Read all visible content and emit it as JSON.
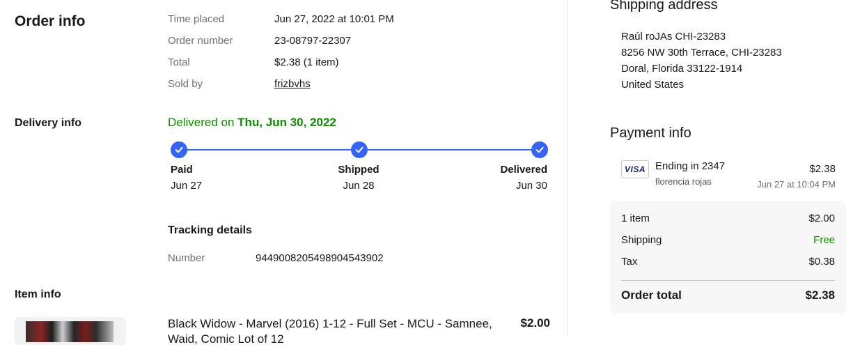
{
  "order_info": {
    "title": "Order info",
    "rows": [
      {
        "label": "Time placed",
        "value": "Jun 27, 2022 at 10:01 PM"
      },
      {
        "label": "Order number",
        "value": "23-08797-22307"
      },
      {
        "label": "Total",
        "value": "$2.38 (1 item)"
      },
      {
        "label": "Sold by",
        "value": "frizbvhs"
      }
    ]
  },
  "delivery_info": {
    "title": "Delivery info",
    "status_prefix": "Delivered on ",
    "status_date": "Thu, Jun 30, 2022",
    "steps": [
      {
        "name": "Paid",
        "date": "Jun 27"
      },
      {
        "name": "Shipped",
        "date": "Jun 28"
      },
      {
        "name": "Delivered",
        "date": "Jun 30"
      }
    ],
    "tracking_title": "Tracking details",
    "tracking_label": "Number",
    "tracking_number": "9449008205498904543902"
  },
  "item_info": {
    "title": "Item info",
    "item_title_line1": "Black Widow - Marvel (2016) 1-12 - Full Set - MCU - Samnee,",
    "item_title_line2": "Waid, Comic Lot of 12",
    "item_price": "$2.00"
  },
  "shipping_address": {
    "title": "Shipping address",
    "lines": [
      "Raúl roJAs CHI-23283",
      "8256 NW 30th Terrace, CHI-23283",
      "Doral, Florida 33122-1914",
      "United States"
    ]
  },
  "payment_info": {
    "title": "Payment info",
    "card_brand": "VISA",
    "card_ending": "Ending in 2347",
    "card_holder": "florencia rojas",
    "amount": "$2.38",
    "timestamp": "Jun 27 at 10:04 PM",
    "summary": [
      {
        "label": "1 item",
        "value": "$2.00"
      },
      {
        "label": "Shipping",
        "value": "Free"
      },
      {
        "label": "Tax",
        "value": "$0.38"
      }
    ],
    "total_label": "Order total",
    "total_value": "$2.38"
  },
  "colors": {
    "accent_blue": "#3665f3",
    "success_green": "#108a00",
    "label_gray": "#707070"
  }
}
